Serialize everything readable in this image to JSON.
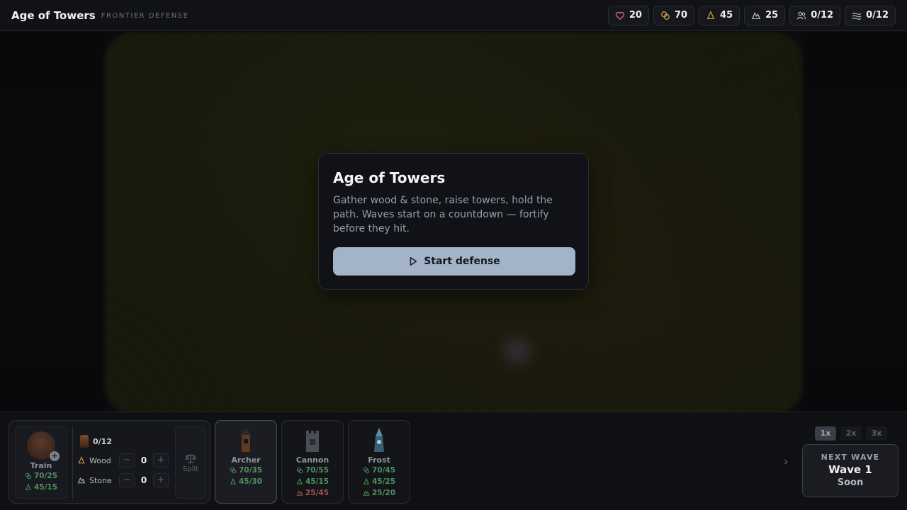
{
  "header": {
    "title": "Age of Towers",
    "subtitle": "FRONTIER DEFENSE",
    "stats": [
      {
        "icon": "heart-icon",
        "value": "20",
        "color": "#e06b6b"
      },
      {
        "icon": "coins-icon",
        "value": "70",
        "color": "#d4a24c"
      },
      {
        "icon": "wood-icon",
        "value": "45",
        "color": "#d4a24c"
      },
      {
        "icon": "stone-icon",
        "value": "25",
        "color": "#b9bcc4"
      },
      {
        "icon": "workers-icon",
        "value": "0/12",
        "color": "#b9bcc4"
      },
      {
        "icon": "waves-icon",
        "value": "0/12",
        "color": "#b9bcc4"
      }
    ]
  },
  "modal": {
    "title": "Age of Towers",
    "text": "Gather wood & stone, raise towers, hold the path. Waves start on a countdown — fortify before they hit.",
    "button_label": "Start defense"
  },
  "train": {
    "label": "Train",
    "costs": [
      {
        "icon": "coins-icon",
        "value": "70/25"
      },
      {
        "icon": "wood-icon",
        "value": "45/15"
      }
    ],
    "workers": "0/12",
    "resources": [
      {
        "name": "Wood",
        "icon": "wood-icon",
        "value": "0"
      },
      {
        "name": "Stone",
        "icon": "stone-icon",
        "value": "0"
      }
    ],
    "split_label": "Split"
  },
  "towers": [
    {
      "name": "Archer",
      "costs": [
        {
          "icon": "coins-icon",
          "value": "70/35",
          "ok": true
        },
        {
          "icon": "wood-icon",
          "value": "45/30",
          "ok": true
        }
      ]
    },
    {
      "name": "Cannon",
      "costs": [
        {
          "icon": "coins-icon",
          "value": "70/55",
          "ok": true
        },
        {
          "icon": "wood-icon",
          "value": "45/15",
          "ok": true
        },
        {
          "icon": "stone-icon",
          "value": "25/45",
          "ok": false
        }
      ]
    },
    {
      "name": "Frost",
      "costs": [
        {
          "icon": "coins-icon",
          "value": "70/45",
          "ok": true
        },
        {
          "icon": "wood-icon",
          "value": "45/25",
          "ok": true
        },
        {
          "icon": "stone-icon",
          "value": "25/20",
          "ok": true
        }
      ]
    }
  ],
  "speed": [
    "1x",
    "2x",
    "3x"
  ],
  "speed_active": "1x",
  "next_wave": {
    "label": "NEXT WAVE",
    "wave": "Wave 1",
    "status": "Soon"
  }
}
